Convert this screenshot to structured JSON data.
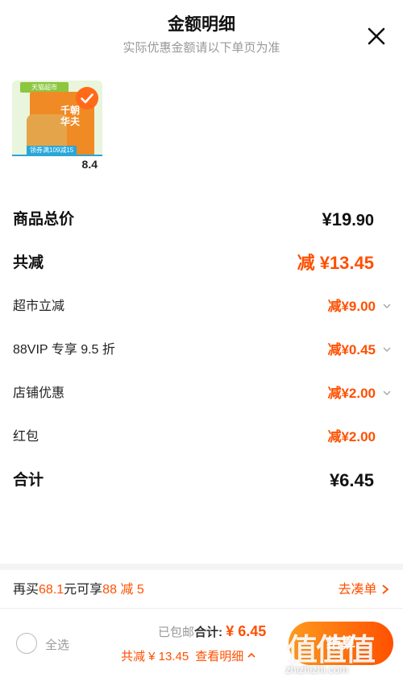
{
  "header": {
    "title": "金额明细",
    "subtitle": "实际优惠金额请以下单页为准"
  },
  "product": {
    "store_tag": "天猫超市",
    "box_text": "千朝\n华夫",
    "promo": "领券满109减15",
    "price": "8.4"
  },
  "rows": {
    "total": {
      "label": "商品总价",
      "symbol": "¥",
      "int": "19",
      "dec": ".90"
    },
    "reduce": {
      "label": "共减",
      "value": "减 ¥13.45"
    },
    "supermarket": {
      "label": "超市立减",
      "value": "减¥9.00"
    },
    "vip": {
      "label": "88VIP 专享 9.5 折",
      "value": "减¥0.45"
    },
    "shop": {
      "label": "店铺优惠",
      "value": "减¥2.00"
    },
    "redpacket": {
      "label": "红包",
      "value": "减¥2.00"
    },
    "sum": {
      "label": "合计",
      "value": "¥6.45"
    }
  },
  "rebuy": {
    "prefix": "再买",
    "amount": "68.1",
    "middle": "元可享",
    "offer": "88 减 5",
    "link": "去凑单"
  },
  "bottom": {
    "select_all": "全选",
    "free_ship": "已包邮",
    "total_label": "合计:",
    "total_symbol": "¥",
    "total_amount": "6.45",
    "reduce_label": "共减 ¥ 13.45",
    "detail_link": "查看明细",
    "checkout": "结算"
  },
  "watermark": {
    "logo": "值值值",
    "site": "zhizhizhi.com"
  },
  "colors": {
    "accent": "#ff5000",
    "check": "#ff6a1a"
  }
}
